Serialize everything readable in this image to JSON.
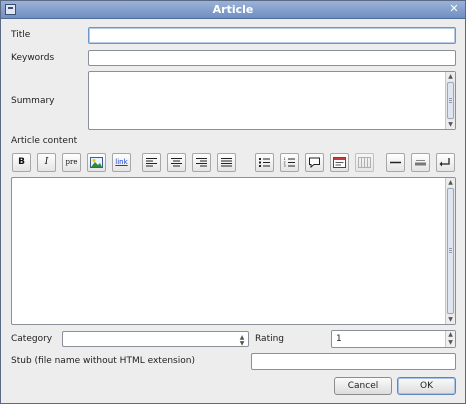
{
  "window": {
    "title": "Article"
  },
  "labels": {
    "title": "Title",
    "keywords": "Keywords",
    "summary": "Summary",
    "article_content": "Article content",
    "category": "Category",
    "rating": "Rating",
    "stub": "Stub (file name without HTML extension)"
  },
  "fields": {
    "title_value": "",
    "keywords_value": "",
    "summary_value": "",
    "content_value": "",
    "category_selected": "",
    "rating_value": "1",
    "stub_value": ""
  },
  "toolbar": {
    "bold": "B",
    "italic": "I",
    "pre": "pre",
    "image": "image-icon",
    "link": "link",
    "align_left": "align-left-icon",
    "align_center": "align-center-icon",
    "align_right": "align-right-icon",
    "justify": "justify-icon",
    "bullet_list": "bullet-list-icon",
    "numbered_list": "numbered-list-icon",
    "quote": "speech-bubble-icon",
    "code": "code-block-icon",
    "table": "table-icon",
    "hr": "horizontal-rule-icon",
    "hr_thick": "horizontal-rule-block-icon",
    "line_break": "line-break-icon"
  },
  "buttons": {
    "cancel": "Cancel",
    "ok": "OK"
  },
  "colors": {
    "titlebar": "#7f9bc9",
    "focus": "#6f95c7",
    "link": "#1a3fd0"
  }
}
